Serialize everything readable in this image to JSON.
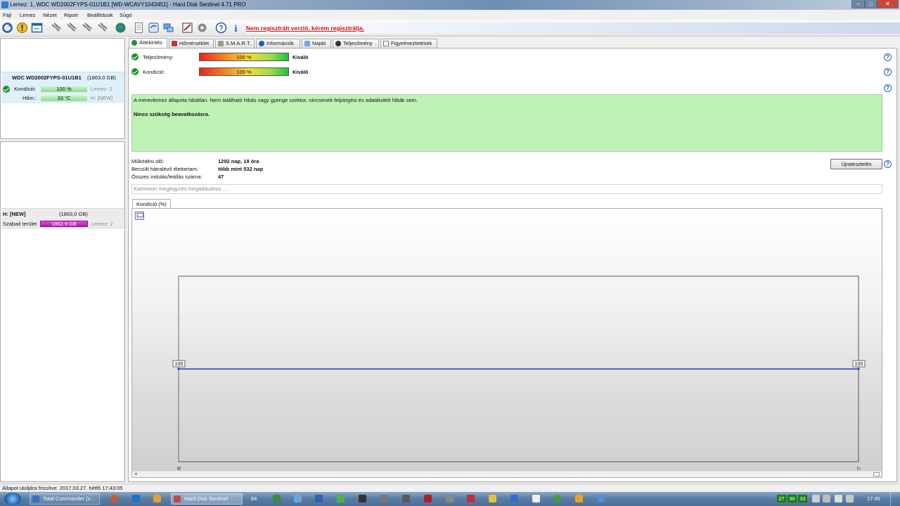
{
  "window": {
    "title": "Lemez: 1, WDC WD2002FYPS-01U1B1 [WD-WCAVY1043451]  -  Hard Disk Sentinel 4.71 PRO"
  },
  "menu": [
    "Fájl",
    "Lemez",
    "Nézet",
    "Riport",
    "Beállítások",
    "Súgó"
  ],
  "toolbar": {
    "registration_link": "Nem regisztrált verzió, kérem regisztrálja."
  },
  "disk_panel": {
    "disk_name": "WDC WD2002FYPS-01U1B1",
    "disk_size": "(1863,0 GB)",
    "condition_label": "Kondíció:",
    "condition_value": "100 %",
    "condition_pct": 100,
    "disk_ref": "Lemez: 1",
    "temp_label": "Hőm.:",
    "temp_value": "33 °C",
    "partition_ref": "H: [NEW]"
  },
  "partition_panel": {
    "name": "H: [NEW]",
    "size": "(1863,0 GB)",
    "free_label": "Szabad terület",
    "free_value": "1862,9 GB",
    "disk_ref": "Lemez: 1"
  },
  "tabs": [
    "Áttekintés",
    "Hőmérséklet",
    "S.M.A.R.T.",
    "Információk",
    "Napló",
    "Teljesítmény",
    "Figyelmeztetések"
  ],
  "overview": {
    "performance_label": "Teljesítmény:",
    "performance_value": "100 %",
    "performance_pct": 100,
    "performance_rating": "Kiváló",
    "condition_label": "Kondíció:",
    "condition_value": "100 %",
    "condition_pct": 100,
    "condition_rating": "Kiváló",
    "status_text": "A merevlemez állapota hibátlan. Nem található hibás vagy gyenge szektor, nincsenek felpörgési és adatátviteli hibák sem.",
    "status_action": "Nincs szükség beavatkozásra.",
    "power_on_label": "Működési idő:",
    "power_on_value": "1292 nap, 18 óra",
    "remaining_label": "Becsült hátralévő élettartam:",
    "remaining_value": "több mint 532 nap",
    "start_stop_label": "Összes indulás/leállás száma:",
    "start_stop_value": "47",
    "reset_button": "Újratesztelés",
    "note_placeholder": "Kattintson megjegyzés megadásához ...",
    "chart_tab": "Kondíció  (%)"
  },
  "chart_data": {
    "type": "line",
    "x": [
      "2017.03.26",
      "2017.03.27"
    ],
    "series": [
      {
        "values": [
          100,
          100
        ]
      }
    ],
    "ylim": [
      0,
      200
    ],
    "data_labels": [
      "100",
      "100"
    ],
    "color": "#2233cc"
  },
  "statusbar": {
    "text": "Állapot utoljára frissítve: 2017.03.27. hétfő 17:43:05"
  },
  "taskbar": {
    "items": [
      "Total Commander (x...",
      "Hard Disk Sentinel"
    ],
    "item64": "64",
    "tray_temps": [
      "27",
      "30",
      "33"
    ],
    "clock": "17:45"
  }
}
